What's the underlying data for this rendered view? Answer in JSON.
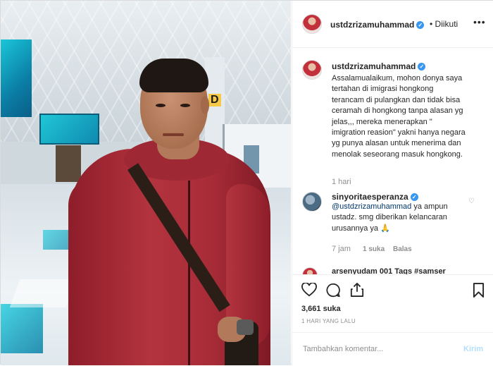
{
  "post": {
    "username": "ustdzrizamuhammad",
    "verified_icon": "verified-badge-icon",
    "follow_status": "Diikuti",
    "more_label": "•••"
  },
  "caption": {
    "username": "ustdzrizamuhammad",
    "text": "Assalamualaikum, mohon donya saya tertahan di imigrasi hongkong terancam di pulangkan dan tidak bisa ceramah di hongkong tanpa alasan yg jelas,,, mereka menerapkan \" imigration reasion\" yakni hanya negara yg punya alasan untuk menerima dan menolak seseorang masuk hongkong.",
    "time": "1 hari"
  },
  "comments": [
    {
      "username": "sinyoritaesperanza",
      "mention": "@ustdzrizamuhammad",
      "text": " ya ampun ustadz. smg diberikan kelancaran urusannya ya 🙏",
      "time": "7 jam",
      "likes": "1 suka",
      "reply": "Balas"
    }
  ],
  "cut_comment_text": "arsenyudam 001 Tags #samser",
  "actions": {
    "like_icon": "heart-icon",
    "comment_icon": "comment-icon",
    "share_icon": "share-icon",
    "save_icon": "bookmark-icon",
    "likes": "3,661 suka",
    "time_ago": "1 HARI YANG LALU"
  },
  "add_comment": {
    "placeholder": "Tambahkan komentar...",
    "send_label": "Kirim"
  },
  "colors": {
    "link": "#003569",
    "verified": "#3897f0",
    "muted": "#8e8e8e",
    "send_disabled": "#b2dffc"
  }
}
